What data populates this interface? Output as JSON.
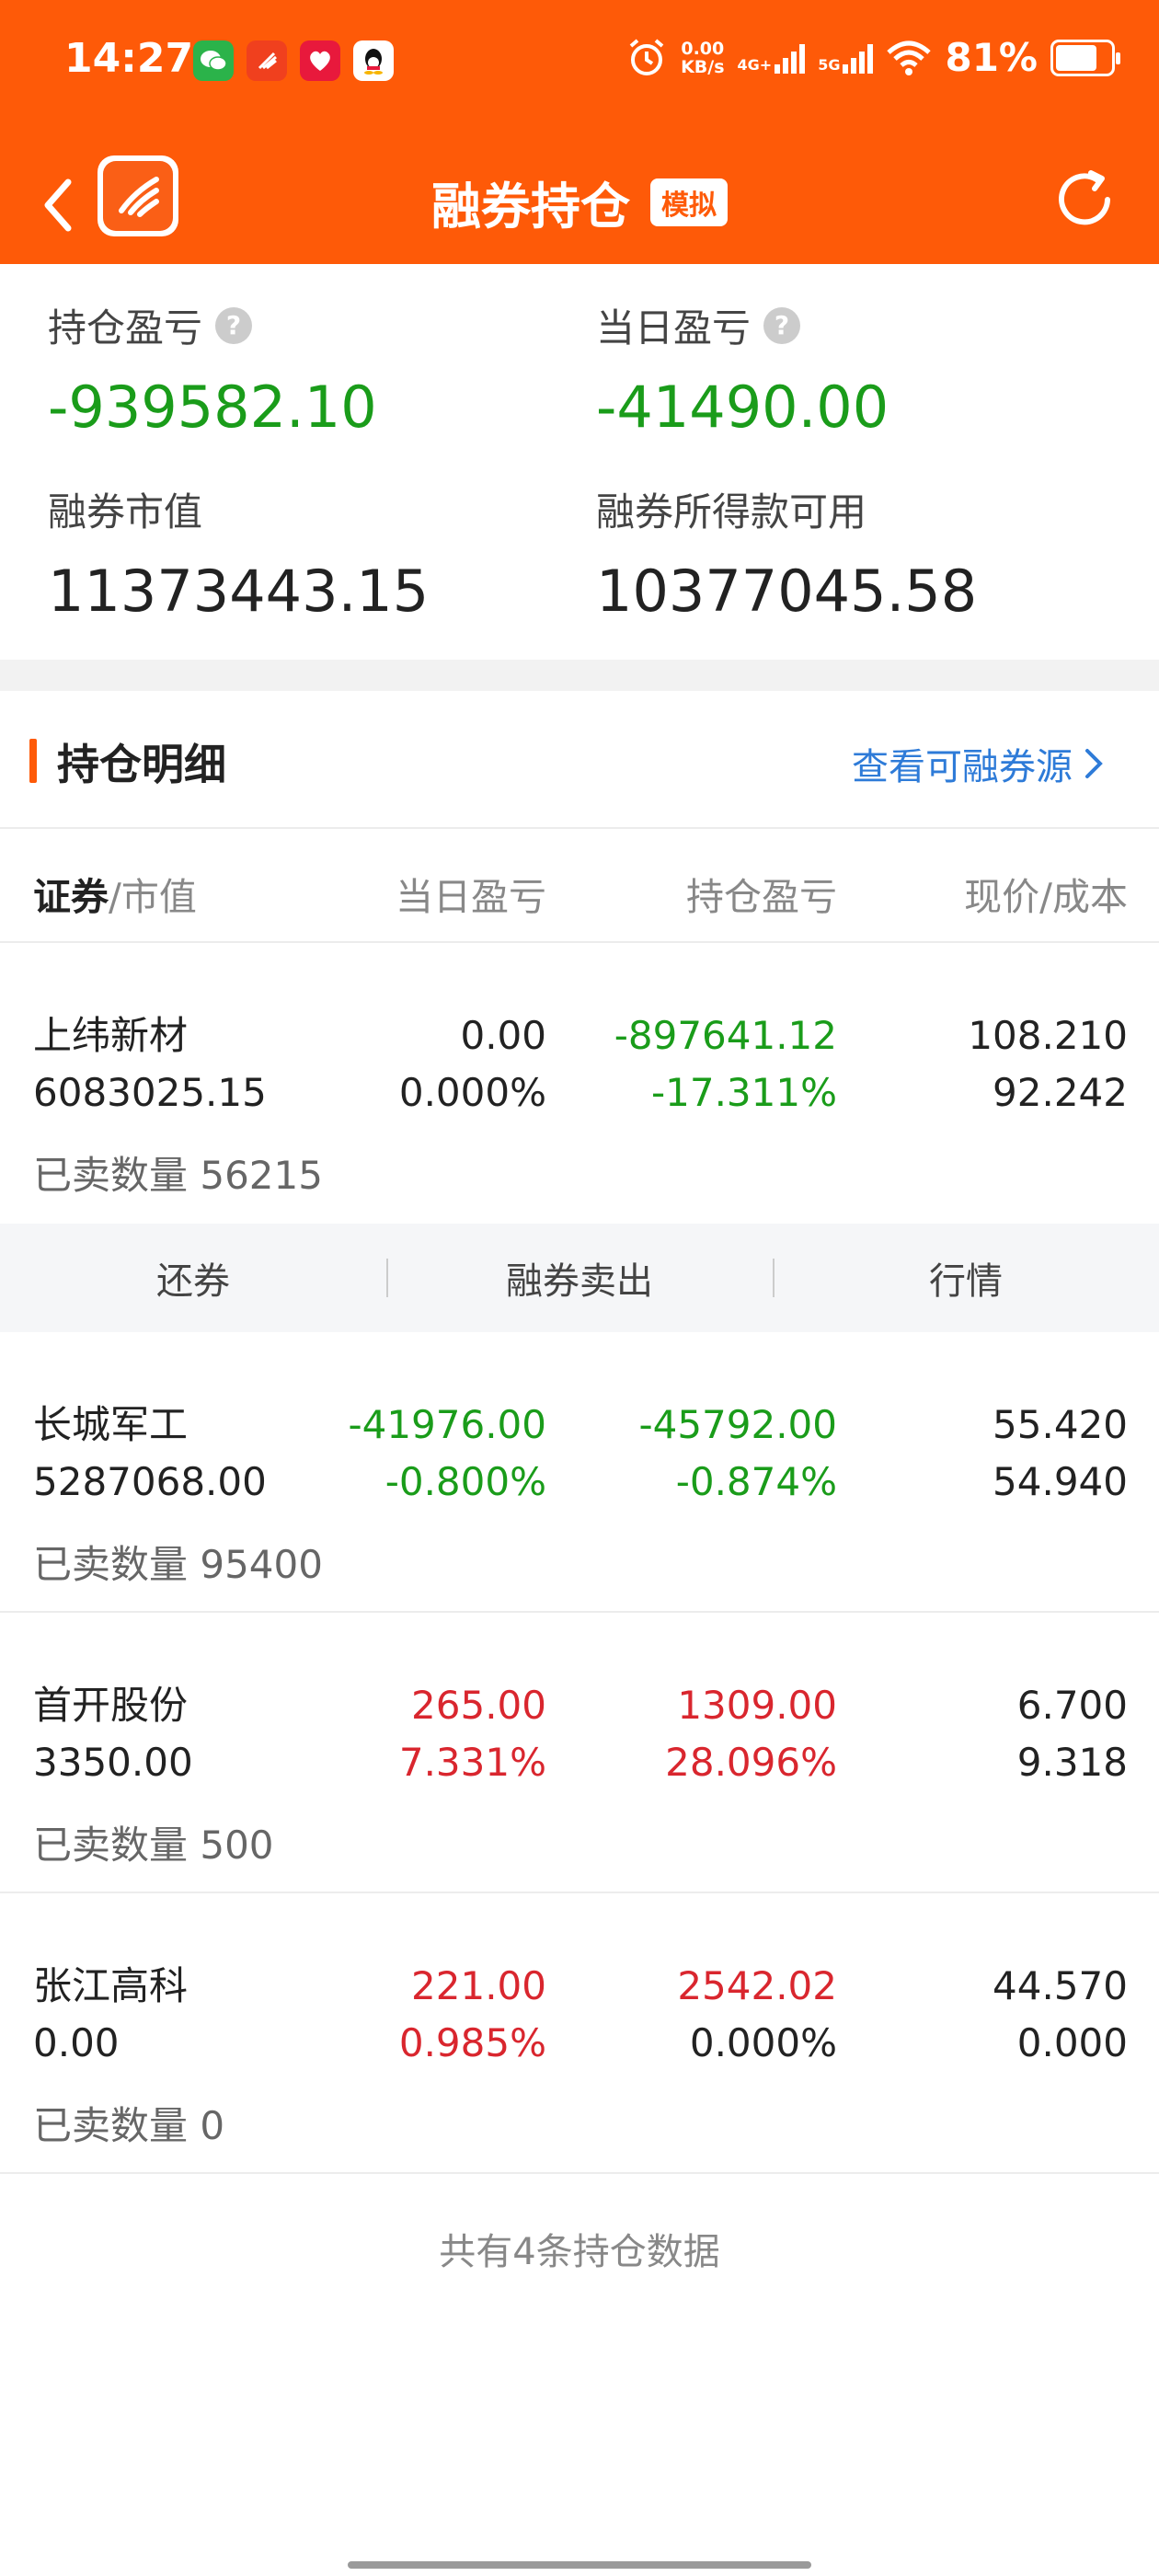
{
  "status_bar": {
    "time": "14:27",
    "net_speed_top": "0.00",
    "net_speed_bottom": "KB/s",
    "signal1": "4G+",
    "signal2": "5G",
    "battery": "81%",
    "app_icons": [
      "wechat-icon",
      "tonghuashun-icon",
      "redbook-icon",
      "qq-icon"
    ]
  },
  "nav": {
    "title": "融券持仓",
    "badge": "模拟"
  },
  "summary": {
    "holding_pl_label": "持仓盈亏",
    "holding_pl_value": "-939582.10",
    "daily_pl_label": "当日盈亏",
    "daily_pl_value": "-41490.00",
    "market_value_label": "融券市值",
    "market_value_value": "11373443.15",
    "available_label": "融券所得款可用",
    "available_value": "10377045.58"
  },
  "section": {
    "title": "持仓明细",
    "link": "查看可融券源"
  },
  "columns": {
    "security": "证券",
    "market_value": "/市值",
    "daily_pl": "当日盈亏",
    "holding_pl": "持仓盈亏",
    "price_cost": "现价/成本"
  },
  "rows": [
    {
      "name": "上纬新材",
      "market_value": "6083025.15",
      "daily_pl": "0.00",
      "daily_pct": "0.000%",
      "holding_pl": "-897641.12",
      "holding_pct": "-17.311%",
      "price": "108.210",
      "cost": "92.242",
      "sold": "已卖数量 56215"
    },
    {
      "name": "长城军工",
      "market_value": "5287068.00",
      "daily_pl": "-41976.00",
      "daily_pct": "-0.800%",
      "holding_pl": "-45792.00",
      "holding_pct": "-0.874%",
      "price": "55.420",
      "cost": "54.940",
      "sold": "已卖数量 95400"
    },
    {
      "name": "首开股份",
      "market_value": "3350.00",
      "daily_pl": "265.00",
      "daily_pct": "7.331%",
      "holding_pl": "1309.00",
      "holding_pct": "28.096%",
      "price": "6.700",
      "cost": "9.318",
      "sold": "已卖数量 500"
    },
    {
      "name": "张江高科",
      "market_value": "0.00",
      "daily_pl": "221.00",
      "daily_pct": "0.985%",
      "holding_pl": "2542.02",
      "holding_pct": "0.000%",
      "price": "44.570",
      "cost": "0.000",
      "sold": "已卖数量 0"
    }
  ],
  "actions": {
    "repay": "还券",
    "short_sell": "融券卖出",
    "quote": "行情"
  },
  "footer": {
    "count_text": "共有4条持仓数据"
  },
  "colors": {
    "brand": "#fe5a08",
    "gain": "#d9262e",
    "loss": "#1a9c1a",
    "link": "#2e7bd8"
  }
}
